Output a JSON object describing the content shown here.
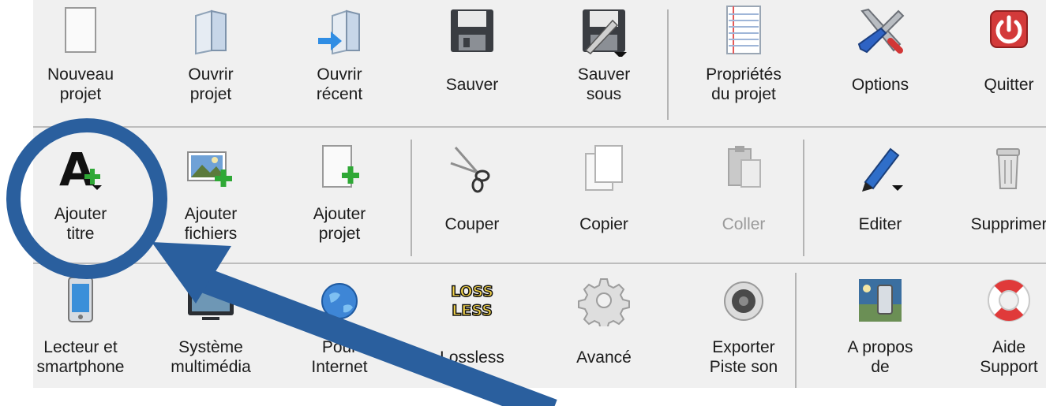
{
  "toolbar": {
    "row1": [
      {
        "label": "Nouveau\nprojet"
      },
      {
        "label": "Ouvrir\nprojet"
      },
      {
        "label": "Ouvrir\nrécent"
      },
      {
        "label": "Sauver"
      },
      {
        "label": "Sauver\nsous"
      },
      {
        "label": "Propriétés\ndu projet"
      },
      {
        "label": "Options"
      },
      {
        "label": "Quitter"
      }
    ],
    "row2": [
      {
        "label": "Ajouter\ntitre"
      },
      {
        "label": "Ajouter\nfichiers"
      },
      {
        "label": "Ajouter\nprojet"
      },
      {
        "label": "Couper"
      },
      {
        "label": "Copier"
      },
      {
        "label": "Coller",
        "state": "disabled"
      },
      {
        "label": "Editer"
      },
      {
        "label": "Supprimer"
      }
    ],
    "row3": [
      {
        "label": "Lecteur et\nsmartphone"
      },
      {
        "label": "Système\nmultimédia"
      },
      {
        "label": "Pour\nInternet"
      },
      {
        "label": "Lossless"
      },
      {
        "label": "Avancé"
      },
      {
        "label": "Exporter\nPiste son"
      },
      {
        "label": "A propos\nde"
      },
      {
        "label": "Aide\nSupport"
      }
    ]
  },
  "icons": {
    "lossless_text_top": "LOSS",
    "lossless_text_bottom": "LESS"
  },
  "annotation": {
    "color": "#2a5f9e",
    "target": "Ajouter titre"
  }
}
